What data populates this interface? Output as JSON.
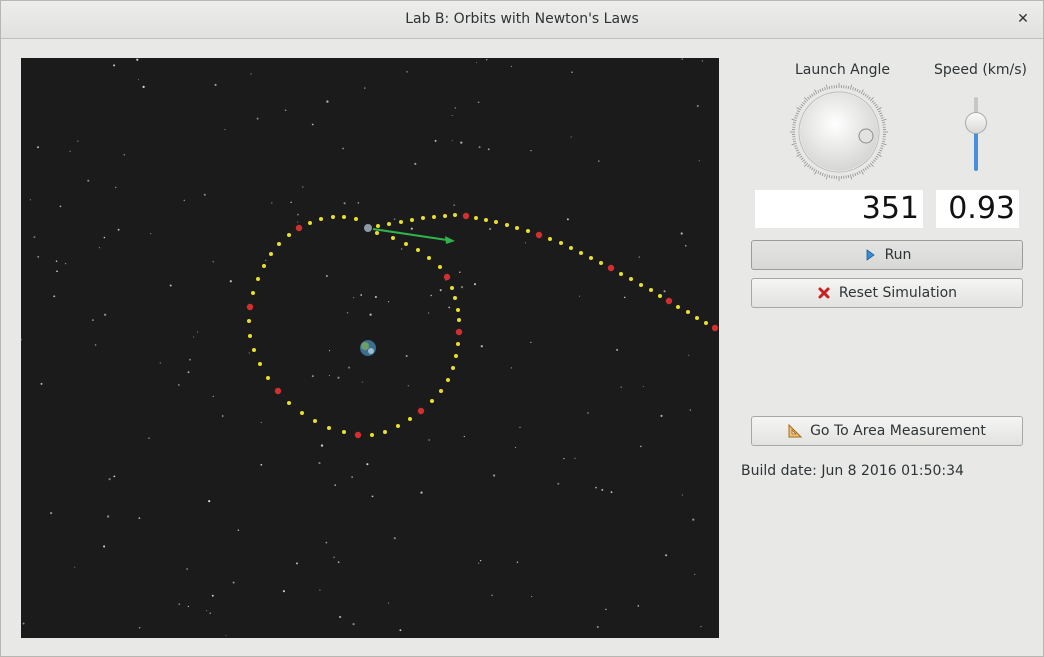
{
  "window": {
    "title": "Lab B: Orbits with Newton's Laws",
    "close_icon": "close-icon"
  },
  "controls": {
    "launch_angle_label": "Launch Angle",
    "speed_label": "Speed (km/s)",
    "launch_angle_value": "351",
    "speed_value": "0.93",
    "speed_level": 0.65,
    "run_label": "Run",
    "reset_label": "Reset Simulation",
    "area_label": "Go To Area Measurement"
  },
  "build": {
    "text": "Build date: Jun  8 2016 01:50:34"
  },
  "colors": {
    "space": "#1b1b1b",
    "orbit_dot": "#e8e02a",
    "orbit_marker": "#d23030",
    "velocity_arrow": "#2fb34a",
    "slider_fill": "#4a90d9"
  }
}
